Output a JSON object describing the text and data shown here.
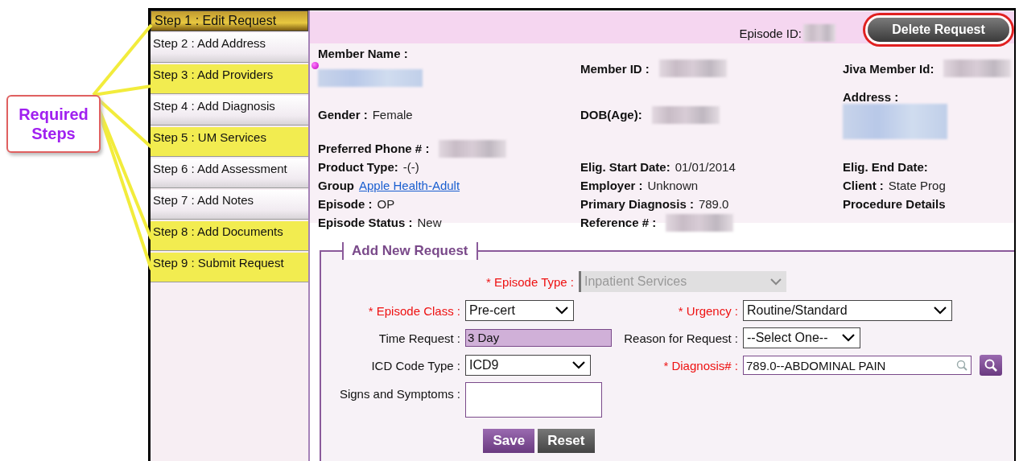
{
  "callout": {
    "text": "Required Steps"
  },
  "steps": [
    {
      "label": "Step 1 : Edit Request",
      "selected": true,
      "required": true
    },
    {
      "label": "Step 2 : Add Address",
      "selected": false,
      "required": false
    },
    {
      "label": "Step 3 : Add Providers",
      "selected": false,
      "required": true
    },
    {
      "label": "Step 4 : Add Diagnosis",
      "selected": false,
      "required": false
    },
    {
      "label": "Step 5 : UM Services",
      "selected": false,
      "required": true
    },
    {
      "label": "Step 6 : Add Assessment",
      "selected": false,
      "required": false
    },
    {
      "label": "Step 7 : Add Notes",
      "selected": false,
      "required": false
    },
    {
      "label": "Step 8 : Add Documents",
      "selected": false,
      "required": true
    },
    {
      "label": "Step 9 : Submit Request",
      "selected": false,
      "required": true
    }
  ],
  "header": {
    "episode_id_label": "Episode ID:",
    "delete_button": {
      "label": "Delete Request",
      "circled": true
    }
  },
  "info_rows": [
    {
      "left": {
        "label": "Member Name :",
        "blurred": true,
        "dot": true,
        "stacked": true
      },
      "middle": {
        "label": "Member ID :",
        "blurred": true
      },
      "right": {
        "label": "Jiva Member Id:",
        "blurred": true
      }
    },
    {
      "left": {
        "label": "Gender :",
        "value": "Female"
      },
      "middle": {
        "label": "DOB(Age):",
        "blurred": true
      },
      "right": {
        "label": "Address :",
        "blurred": true,
        "stacked": true
      }
    },
    {
      "left": {
        "label": "Preferred Phone # :",
        "blurred": true
      }
    },
    {
      "left": {
        "label": "Product Type:",
        "value": "-(-)"
      },
      "middle": {
        "label": "Elig. Start Date:",
        "value": "01/01/2014"
      },
      "right": {
        "label": "Elig. End Date:"
      }
    },
    {
      "left": {
        "label": "Group",
        "value": "Apple Health-Adult",
        "link": true
      },
      "middle": {
        "label": "Employer :",
        "value": "Unknown"
      },
      "right": {
        "label": "Client :",
        "value": "State Prog"
      }
    },
    {
      "left": {
        "label": "Episode :",
        "value": "OP"
      },
      "middle": {
        "label": "Primary Diagnosis :",
        "value": "789.0"
      },
      "right": {
        "label": "Procedure Details"
      }
    },
    {
      "left": {
        "label": "Episode Status :",
        "value": "New"
      },
      "middle": {
        "label": "Reference # :",
        "blurred": true
      }
    }
  ],
  "form": {
    "title": "Add New Request",
    "top_field": {
      "label": "* Episode Type :",
      "value": "Inpatient Services",
      "required": true,
      "disabled": true
    },
    "rows": [
      [
        {
          "kind": "select",
          "label": "* Episode Class :",
          "value": "Pre-cert",
          "required": true
        },
        {
          "kind": "select",
          "label": "* Urgency :",
          "value": "Routine/Standard",
          "required": true
        }
      ],
      [
        {
          "kind": "text",
          "label": "Time Request :",
          "value": "3 Day",
          "required": false
        },
        {
          "kind": "select",
          "label": "Reason for Request :",
          "value": "--Select One--",
          "required": false
        }
      ],
      [
        {
          "kind": "select",
          "label": "ICD Code Type :",
          "value": "ICD9",
          "required": false
        },
        {
          "kind": "search",
          "label": "* Diagnosis# :",
          "value": "789.0--ABDOMINAL PAIN",
          "required": true
        }
      ],
      [
        {
          "kind": "textarea",
          "label": "Signs and Symptoms :",
          "required": false
        }
      ]
    ],
    "buttons": [
      {
        "label": "Save",
        "kind": "primary"
      },
      {
        "label": "Reset",
        "kind": "secondary"
      }
    ]
  }
}
